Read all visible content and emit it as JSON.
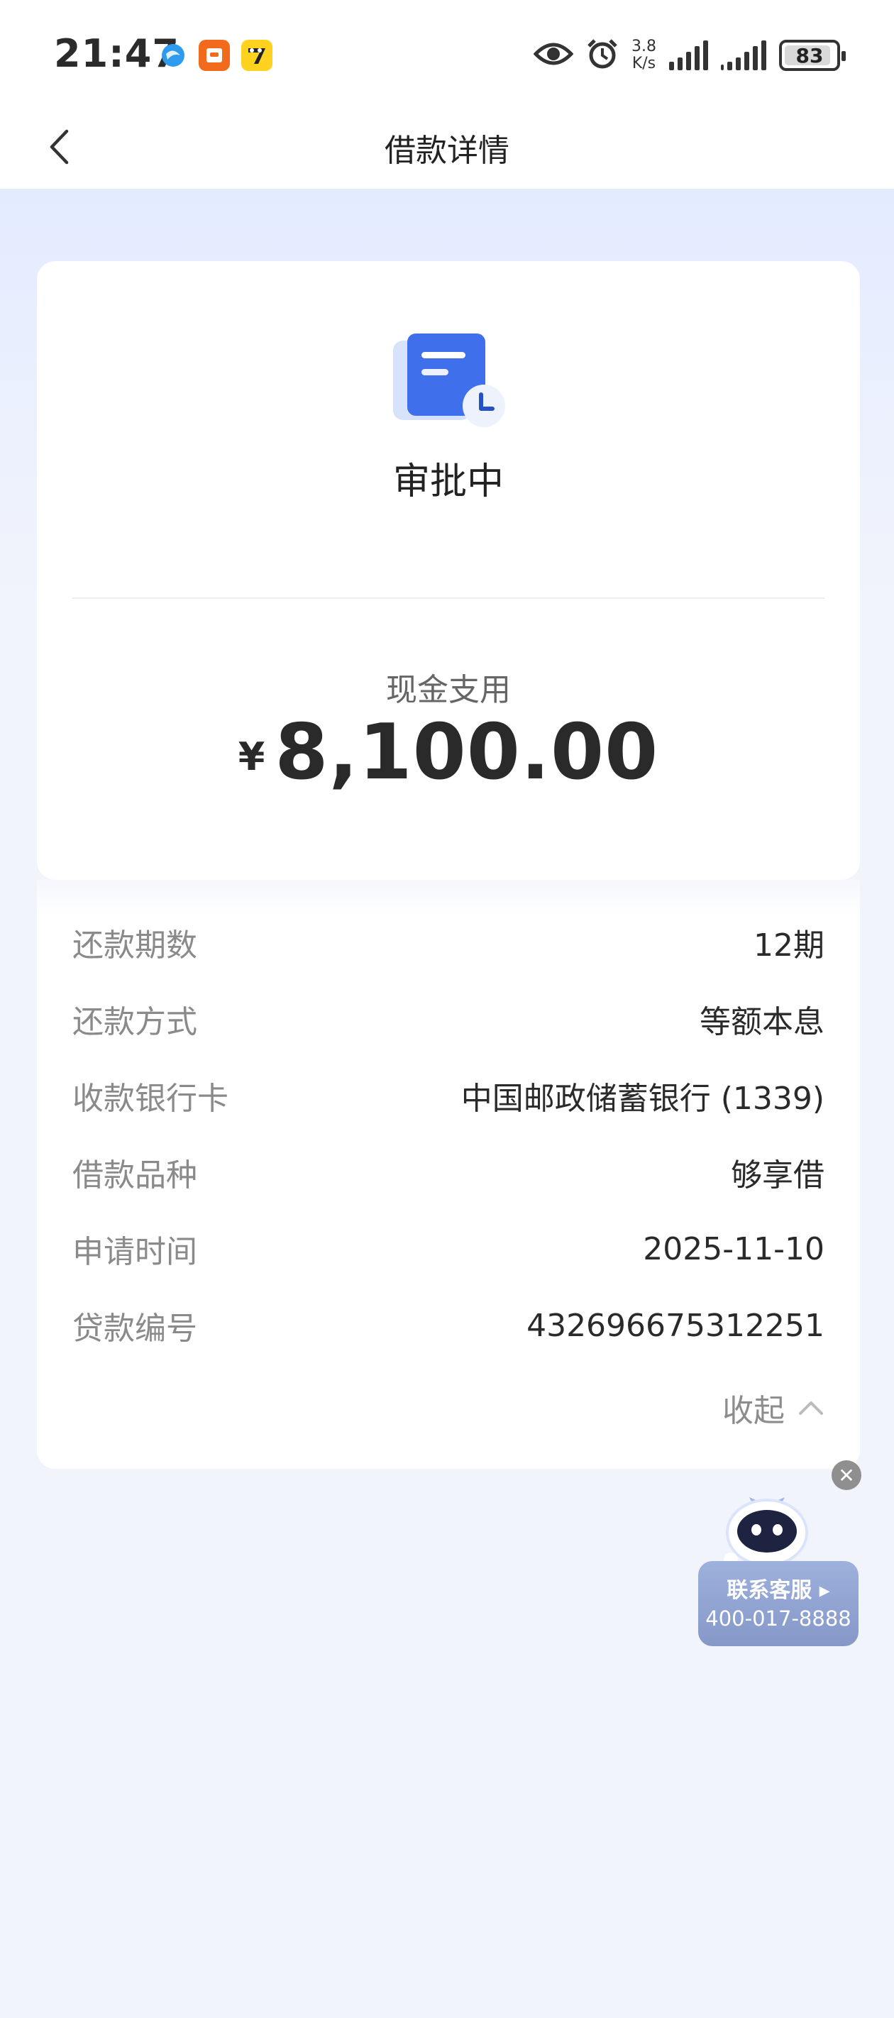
{
  "status_bar": {
    "time": "21:47",
    "network_speed_value": "3.8",
    "network_speed_unit": "K/s",
    "battery": "83"
  },
  "nav": {
    "title": "借款详情"
  },
  "loan": {
    "status": "审批中",
    "amount_label": "现金支用",
    "currency_symbol": "¥",
    "amount": "8,100.00"
  },
  "details": [
    {
      "label": "还款期数",
      "value": "12期"
    },
    {
      "label": "还款方式",
      "value": "等额本息"
    },
    {
      "label": "收款银行卡",
      "value": "中国邮政储蓄银行 (1339)"
    },
    {
      "label": "借款品种",
      "value": "够享借"
    },
    {
      "label": "申请时间",
      "value": "2025-11-10"
    },
    {
      "label": "贷款编号",
      "value": "432696675312251"
    }
  ],
  "collapse_label": "收起",
  "customer_service": {
    "title": "联系客服",
    "phone": "400-017-8888"
  },
  "colors": {
    "accent_blue": "#3b6ff0",
    "cs_bg": "#8b9dcd"
  }
}
